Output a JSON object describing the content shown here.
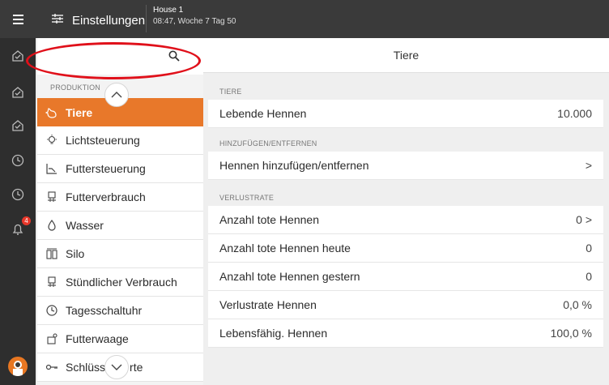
{
  "header": {
    "title": "Einstellungen",
    "house": "House 1",
    "time": "08:47, Woche 7 Tag 50"
  },
  "rail": {
    "notification_count": "4"
  },
  "search": {
    "placeholder": ""
  },
  "sidebar": {
    "section": "PRODUKTION",
    "items": [
      {
        "label": "Tiere",
        "icon": "chicken-icon",
        "active": true
      },
      {
        "label": "Lichtsteuerung",
        "icon": "light-bulb-icon"
      },
      {
        "label": "Futtersteuerung",
        "icon": "feed-control-icon"
      },
      {
        "label": "Futterverbrauch",
        "icon": "feed-consumption-icon"
      },
      {
        "label": "Wasser",
        "icon": "water-drop-icon"
      },
      {
        "label": "Silo",
        "icon": "silo-icon"
      },
      {
        "label": "Stündlicher Verbrauch",
        "icon": "hourly-consumption-icon"
      },
      {
        "label": "Tagesschaltuhr",
        "icon": "clock-icon"
      },
      {
        "label": "Futterwaage",
        "icon": "scale-icon"
      },
      {
        "label": "Schlüss",
        "label_end": "rte",
        "icon": "key-icon"
      }
    ]
  },
  "main": {
    "title": "Tiere",
    "groups": [
      {
        "label": "TIERE",
        "rows": [
          {
            "label": "Lebende Hennen",
            "value": "10.000"
          }
        ]
      },
      {
        "label": "HINZUFÜGEN/ENTFERNEN",
        "rows": [
          {
            "label": "Hennen hinzufügen/entfernen",
            "value": ">"
          }
        ]
      },
      {
        "label": "VERLUSTRATE",
        "rows": [
          {
            "label": "Anzahl tote Hennen",
            "value": "0 >"
          },
          {
            "label": "Anzahl tote Hennen heute",
            "value": "0"
          },
          {
            "label": "Anzahl tote Hennen gestern",
            "value": "0"
          },
          {
            "label": "Verlustrate Hennen",
            "value": "0,0 %"
          },
          {
            "label": "Lebensfähig. Hennen",
            "value": "100,0 %"
          }
        ]
      }
    ]
  },
  "colors": {
    "accent": "#e8782a",
    "topbar": "#3a3a3a",
    "rail": "#2e2e2e",
    "annotation": "#e0101a"
  }
}
